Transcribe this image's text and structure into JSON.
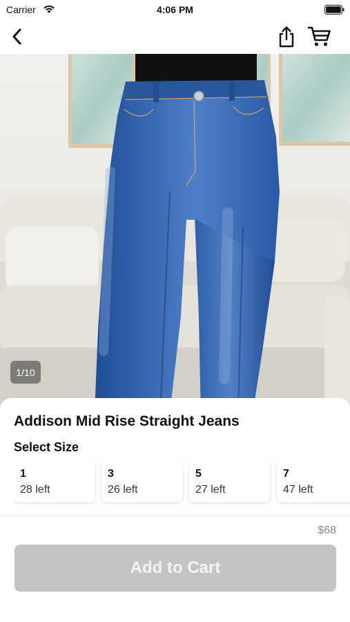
{
  "status_bar": {
    "carrier": "Carrier",
    "time": "4:06 PM"
  },
  "nav": {
    "back_icon": "chevron-left-icon",
    "share_icon": "share-icon",
    "cart_icon": "cart-icon"
  },
  "gallery": {
    "indicator": "1/10"
  },
  "product": {
    "title": "Addison Mid Rise Straight Jeans",
    "size_heading": "Select Size",
    "sizes": [
      {
        "size": "1",
        "stock": "28 left"
      },
      {
        "size": "3",
        "stock": "26 left"
      },
      {
        "size": "5",
        "stock": "27 left"
      },
      {
        "size": "7",
        "stock": "47 left"
      }
    ],
    "price": "$68",
    "add_to_cart_label": "Add to Cart"
  },
  "colors": {
    "button_disabled": "#c4c4c4",
    "denim": "#2c5ba8"
  }
}
